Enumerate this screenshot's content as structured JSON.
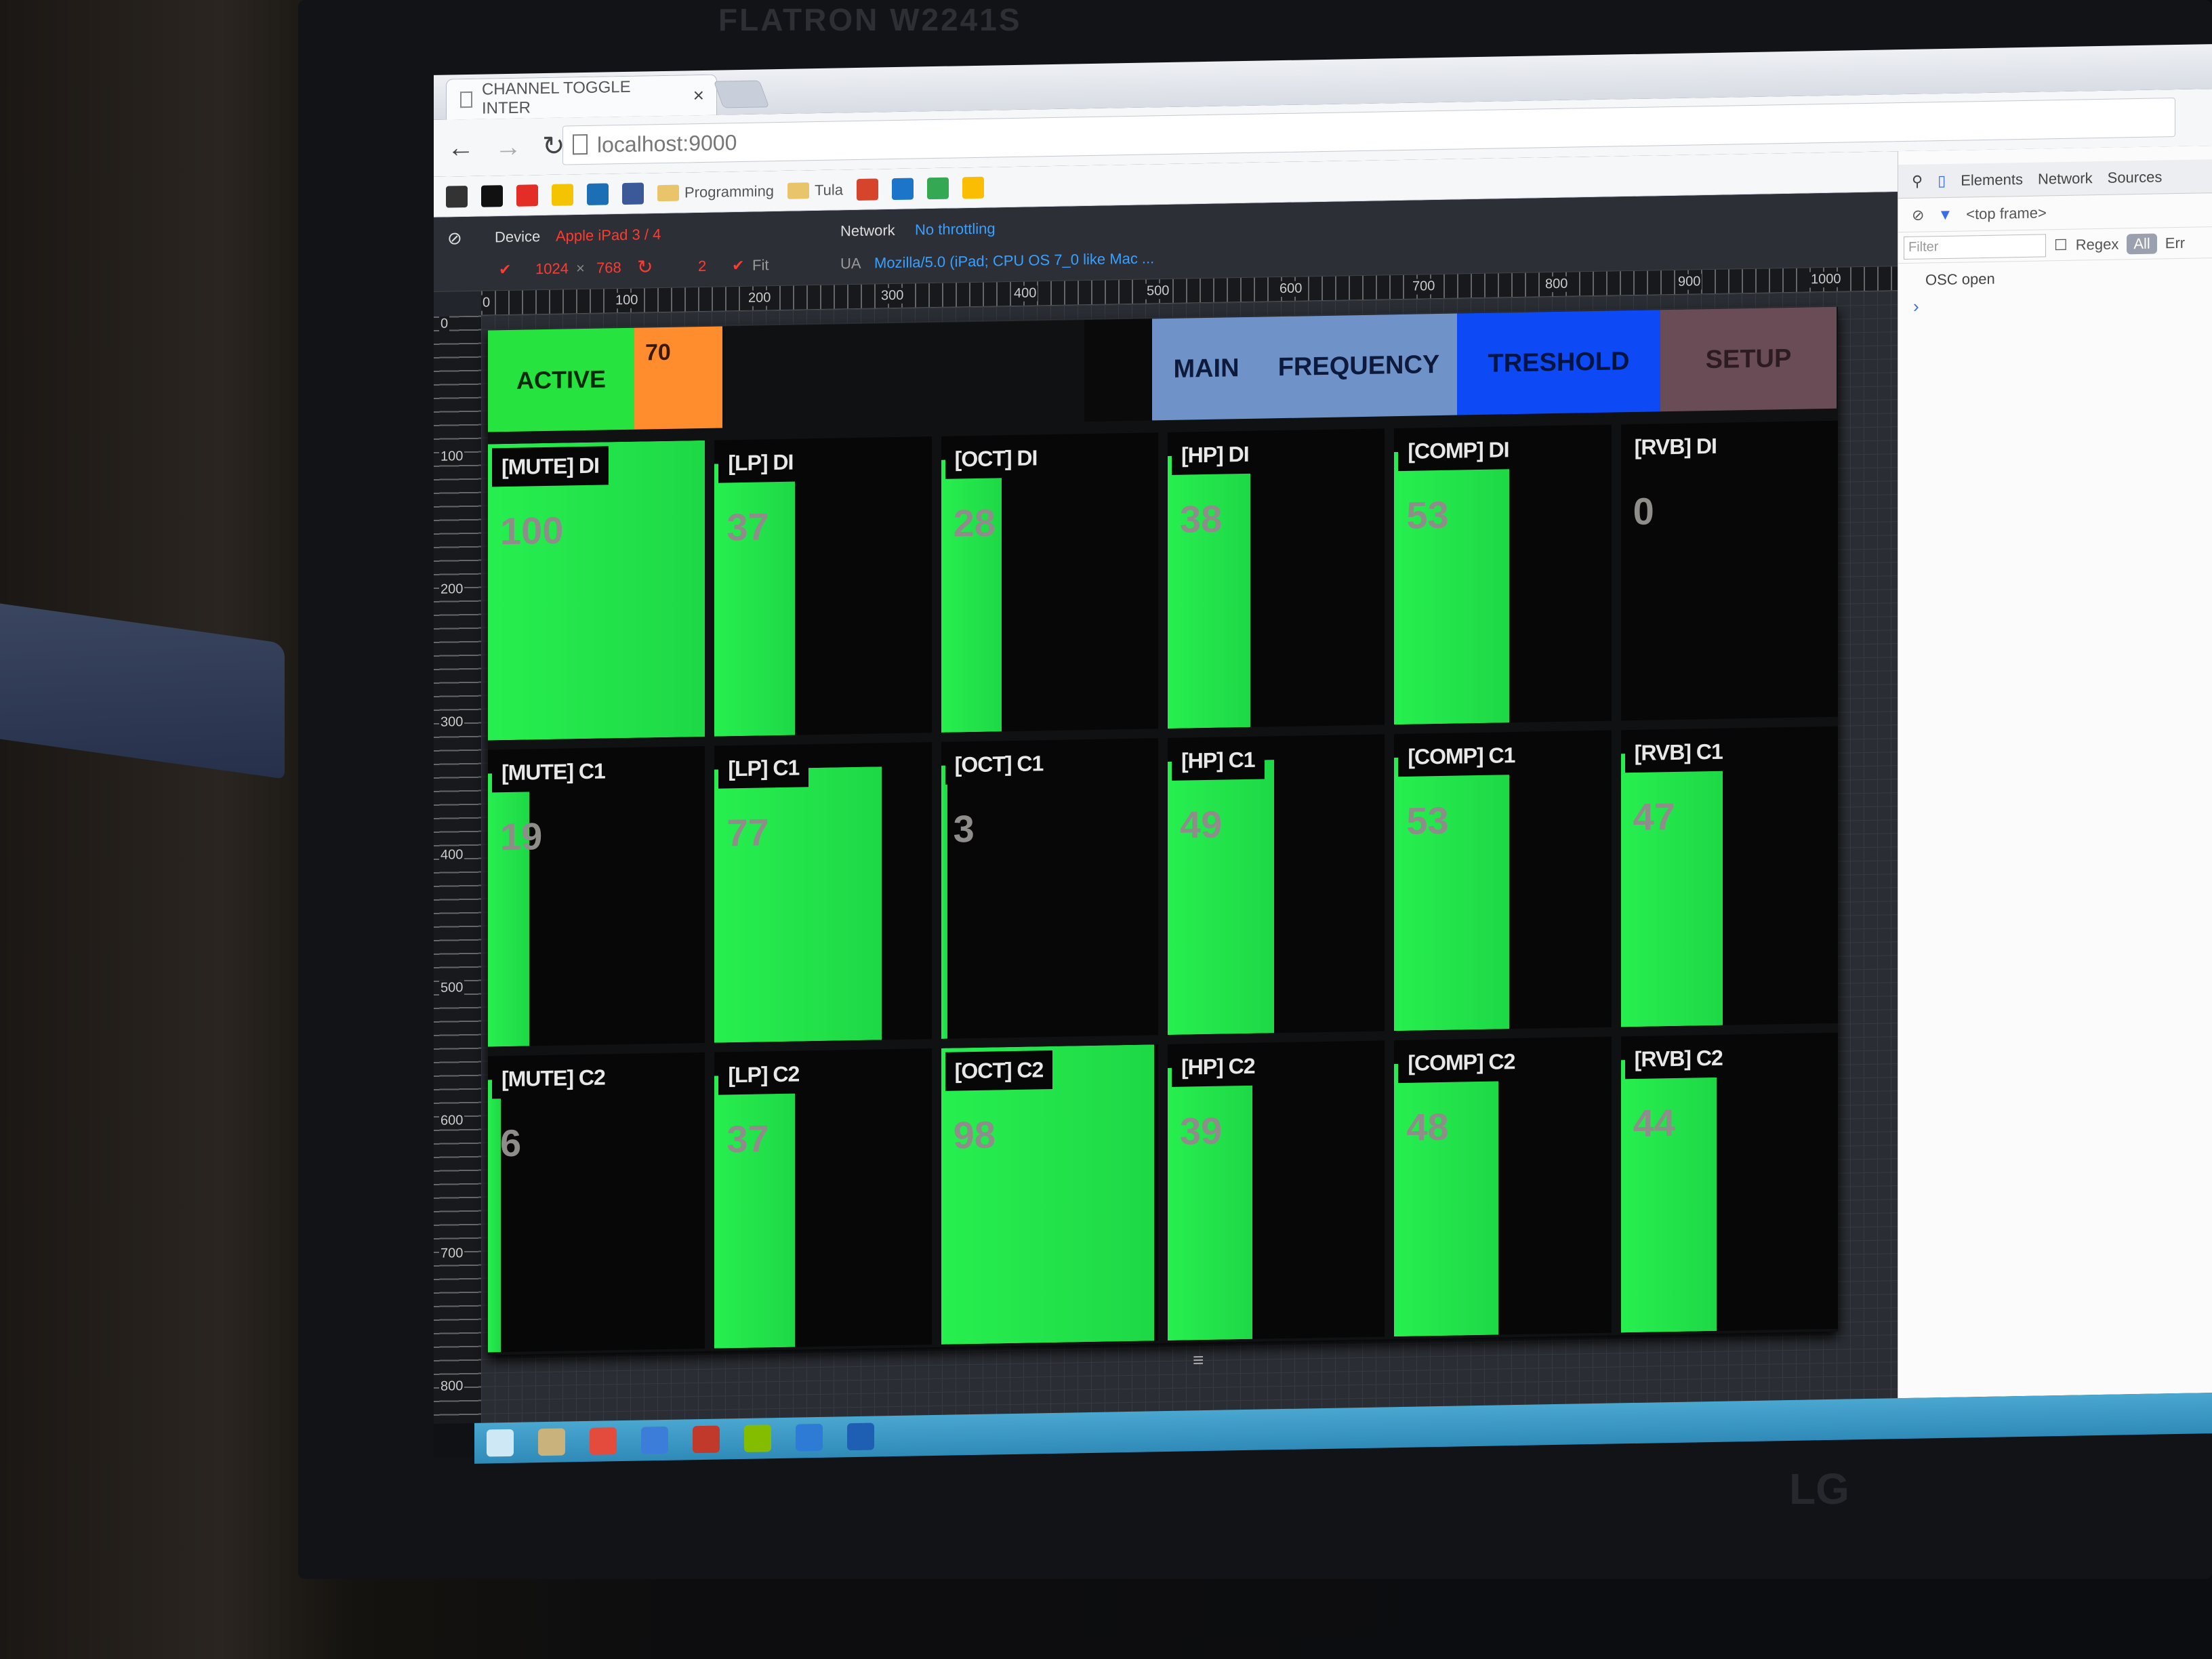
{
  "monitor": {
    "brand_top": "FLATRON W2241S",
    "brand_bottom": "LG"
  },
  "browser": {
    "tab_title": "CHANNEL TOGGLE INTER",
    "tab_close": "×",
    "url": "localhost:9000",
    "bookmarks": [
      {
        "icon": "z-bookmark-icon",
        "color": "#333333"
      },
      {
        "icon": "n-bookmark-icon",
        "color": "#111111"
      },
      {
        "icon": "youtube-icon",
        "color": "#e52d27"
      },
      {
        "icon": "dk-bookmark-icon",
        "color": "#f5c400"
      },
      {
        "icon": "trello-icon",
        "color": "#1c6fb5"
      },
      {
        "icon": "facebook-icon",
        "color": "#3b5998"
      }
    ],
    "bookmark_folders": [
      "Programming",
      "Tula"
    ],
    "bookmarks_after": [
      {
        "icon": "app-red-icon",
        "color": "#d6452b"
      },
      {
        "icon": "app-blue-icon",
        "color": "#1c75c9"
      },
      {
        "icon": "app-map-icon",
        "color": "#34a853"
      },
      {
        "icon": "drive-icon",
        "color": "#fbbc04"
      }
    ]
  },
  "emulation": {
    "device_label": "Device",
    "device_value": "Apple iPad 3 / 4",
    "width": "1024",
    "times": "×",
    "height": "768",
    "scale": "2",
    "fit": "Fit",
    "network_label": "Network",
    "network_value": "No throttling",
    "ua_label": "UA",
    "ua_value": "Mozilla/5.0 (iPad; CPU OS 7_0 like Mac ...",
    "ruler_h": [
      "0",
      "100",
      "200",
      "300",
      "400",
      "500",
      "600",
      "700",
      "800",
      "900",
      "1000"
    ],
    "ruler_v": [
      "0",
      "100",
      "200",
      "300",
      "400",
      "500",
      "600",
      "700",
      "800"
    ]
  },
  "app": {
    "active_label": "ACTIVE",
    "bpm_value": "70",
    "tabs": {
      "main": "MAIN",
      "frequency": "FREQUENCY",
      "threshold": "TRESHOLD",
      "setup": "SETUP"
    },
    "colors": {
      "active": "#27e33f",
      "bpm": "#ff8d2e",
      "bar": "#22e84b",
      "tab": "#6f93c9",
      "tab_selected": "#0d4af5",
      "tab_setup": "#6a4c57"
    },
    "rows": [
      {
        "cells": [
          {
            "label": "[MUTE] DI",
            "value": "100",
            "level": 1.0
          },
          {
            "label": "[LP] DI",
            "value": "37",
            "level": 0.37
          },
          {
            "label": "[OCT] DI",
            "value": "28",
            "level": 0.28
          },
          {
            "label": "[HP] DI",
            "value": "38",
            "level": 0.38
          },
          {
            "label": "[COMP] DI",
            "value": "53",
            "level": 0.53
          },
          {
            "label": "[RVB] DI",
            "value": "0",
            "level": 0.0
          }
        ]
      },
      {
        "cells": [
          {
            "label": "[MUTE] C1",
            "value": "19",
            "level": 0.19
          },
          {
            "label": "[LP] C1",
            "value": "77",
            "level": 0.77
          },
          {
            "label": "[OCT] C1",
            "value": "3",
            "level": 0.03
          },
          {
            "label": "[HP] C1",
            "value": "49",
            "level": 0.49
          },
          {
            "label": "[COMP] C1",
            "value": "53",
            "level": 0.53
          },
          {
            "label": "[RVB] C1",
            "value": "47",
            "level": 0.47
          }
        ]
      },
      {
        "cells": [
          {
            "label": "[MUTE] C2",
            "value": "6",
            "level": 0.06
          },
          {
            "label": "[LP] C2",
            "value": "37",
            "level": 0.37
          },
          {
            "label": "[OCT] C2",
            "value": "98",
            "level": 0.98
          },
          {
            "label": "[HP] C2",
            "value": "39",
            "level": 0.39
          },
          {
            "label": "[COMP] C2",
            "value": "48",
            "level": 0.48
          },
          {
            "label": "[RVB] C2",
            "value": "44",
            "level": 0.44
          }
        ]
      }
    ],
    "resize_handle": "≡"
  },
  "devtools": {
    "tabs": [
      "Elements",
      "Network",
      "Sources"
    ],
    "frame": "<top frame>",
    "filter_placeholder": "Filter",
    "regex": "Regex",
    "all": "All",
    "errors": "Err",
    "log": "OSC open",
    "prompt": "›"
  },
  "taskbar": {
    "icons": [
      {
        "icon": "start-icon",
        "color": "#cfe8f5"
      },
      {
        "icon": "explorer-icon",
        "color": "#c9b27c"
      },
      {
        "icon": "chrome-icon",
        "color": "#e44b3c"
      },
      {
        "icon": "app-icon",
        "color": "#3b7dd8"
      },
      {
        "icon": "media-icon",
        "color": "#c0392b"
      },
      {
        "icon": "spotify-icon",
        "color": "#84bd00"
      },
      {
        "icon": "tool-icon",
        "color": "#2e7bd6"
      },
      {
        "icon": "chart-app-icon",
        "color": "#1e5fb4"
      }
    ]
  }
}
